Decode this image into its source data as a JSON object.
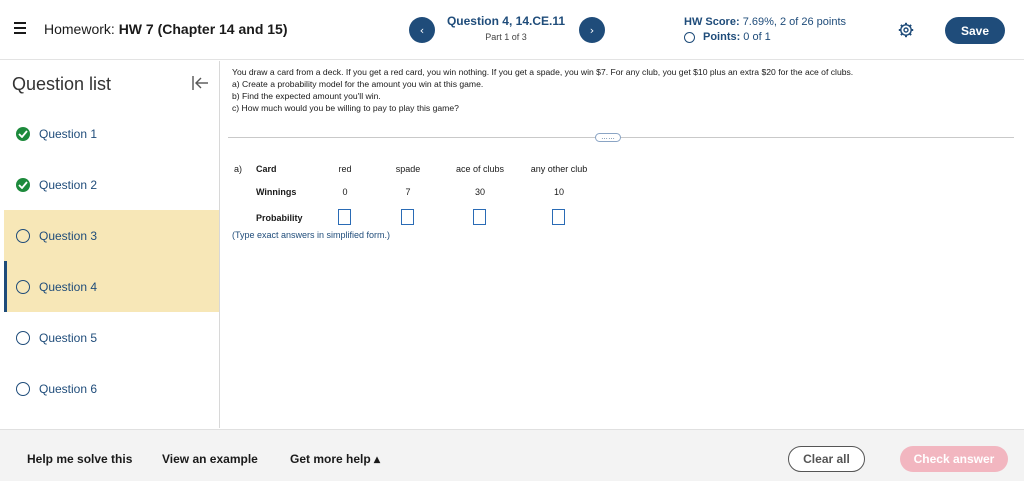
{
  "header": {
    "homework_prefix": "Homework:",
    "homework_name": "HW 7 (Chapter 14 and 15)",
    "question_title": "Question 4, 14.CE.11",
    "question_part": "Part 1 of 3",
    "hw_score_label": "HW Score:",
    "hw_score_value": "7.69%, 2 of 26 points",
    "points_label": "Points:",
    "points_value": "0 of 1",
    "prev_arrow": "‹",
    "next_arrow": "›",
    "save_label": "Save"
  },
  "sidebar": {
    "title": "Question list",
    "items": [
      {
        "label": "Question 1",
        "status": "done"
      },
      {
        "label": "Question 2",
        "status": "done"
      },
      {
        "label": "Question 3",
        "status": "open"
      },
      {
        "label": "Question 4",
        "status": "open"
      },
      {
        "label": "Question 5",
        "status": "open"
      },
      {
        "label": "Question 6",
        "status": "open"
      }
    ]
  },
  "question": {
    "prompt_lines": [
      "You draw a card from a deck. If you get a red card, you win nothing. If you get a spade, you win $7. For any club, you get $10 plus an extra $20 for the ace of clubs.",
      "a) Create a probability model for the amount you win at this game.",
      "b) Find the expected amount you'll win.",
      "c) How much would you be willing to pay to play this game?"
    ],
    "more_label": "……",
    "part_label": "a)",
    "table": {
      "card_label": "Card",
      "winnings_label": "Winnings",
      "probability_label": "Probability",
      "cards": [
        "red",
        "spade",
        "ace of clubs",
        "any other club"
      ],
      "winnings": [
        "0",
        "7",
        "30",
        "10"
      ]
    },
    "hint": "(Type exact answers in simplified form.)"
  },
  "footer": {
    "help_solve": "Help me solve this",
    "view_example": "View an example",
    "get_more_help": "Get more help ▴",
    "clear_all": "Clear all",
    "check_answer": "Check answer"
  },
  "colors": {
    "primary": "#1f4c7a",
    "highlight": "#f7e7b7",
    "done_green": "#1d8a3c",
    "check_disabled": "#f2b6c0"
  }
}
